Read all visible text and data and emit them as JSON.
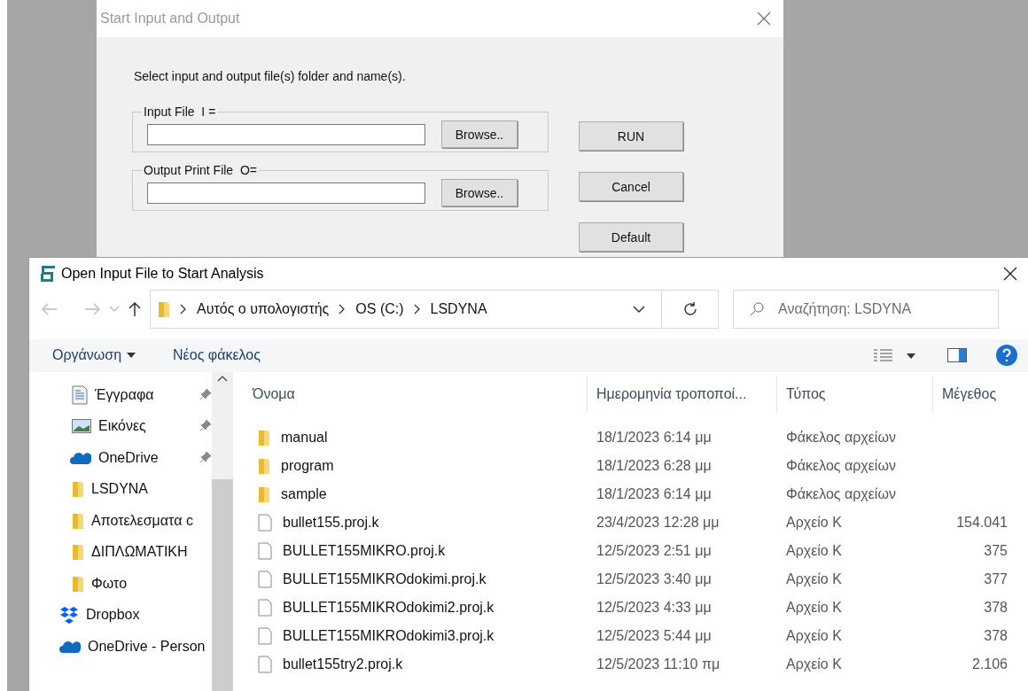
{
  "setup_dialog": {
    "title": "Start Input and Output",
    "instruction": "Select input and output file(s) folder and name(s).",
    "groups": [
      {
        "legend": "Input File  I =",
        "browse": "Browse.."
      },
      {
        "legend": "Output Print File  O=",
        "browse": "Browse.."
      }
    ],
    "buttons": [
      "RUN",
      "Cancel",
      "Default"
    ]
  },
  "open_dialog": {
    "title": "Open Input File to Start Analysis",
    "path": [
      "Αυτός ο υπολογιστής",
      "OS (C:)",
      "LSDYNA"
    ],
    "search": {
      "placeholder": "Αναζήτηση: LSDYNA"
    },
    "toolbar": {
      "organize": "Οργάνωση",
      "new_folder": "Νέος φάκελος"
    },
    "sidebar": [
      {
        "kind": "documents",
        "label": "Έγγραφα",
        "pinned": true
      },
      {
        "kind": "pictures",
        "label": "Εικόνες",
        "pinned": true
      },
      {
        "kind": "cloud",
        "label": "OneDrive",
        "pinned": true
      },
      {
        "kind": "folder",
        "label": "LSDYNA",
        "pinned": false
      },
      {
        "kind": "folder",
        "label": "Αποτελεσματα c",
        "pinned": false
      },
      {
        "kind": "folder",
        "label": "ΔΙΠΛΩΜΑΤΙΚΗ",
        "pinned": false
      },
      {
        "kind": "folder",
        "label": "Φωτο",
        "pinned": false
      },
      {
        "kind": "dropbox",
        "label": "Dropbox",
        "pinned": false
      },
      {
        "kind": "cloud_root",
        "label": "OneDrive - Person",
        "pinned": false
      }
    ],
    "columns": [
      "Όνομα",
      "Ημερομηνία τροποποί...",
      "Τύπος",
      "Μέγεθος"
    ],
    "rows": [
      {
        "kind": "folder",
        "name": "manual",
        "date": "18/1/2023 6:14 μμ",
        "type": "Φάκελος αρχείων"
      },
      {
        "kind": "folder",
        "name": "program",
        "date": "18/1/2023 6:28 μμ",
        "type": "Φάκελος αρχείων"
      },
      {
        "kind": "folder",
        "name": "sample",
        "date": "18/1/2023 6:14 μμ",
        "type": "Φάκελος αρχείων"
      },
      {
        "kind": "file",
        "name": "bullet155.proj.k",
        "date": "23/4/2023 12:28 μμ",
        "type": "Αρχείο K",
        "size": "154.041"
      },
      {
        "kind": "file",
        "name": "BULLET155MIKRO.proj.k",
        "date": "12/5/2023 2:51 μμ",
        "type": "Αρχείο K",
        "size": "375"
      },
      {
        "kind": "file",
        "name": "BULLET155MIKROdokimi.proj.k",
        "date": "12/5/2023 3:40 μμ",
        "type": "Αρχείο K",
        "size": "377"
      },
      {
        "kind": "file",
        "name": "BULLET155MIKROdokimi2.proj.k",
        "date": "12/5/2023 4:33 μμ",
        "type": "Αρχείο K",
        "size": "378"
      },
      {
        "kind": "file",
        "name": "BULLET155MIKROdokimi3.proj.k",
        "date": "12/5/2023 5:44 μμ",
        "type": "Αρχείο K",
        "size": "378"
      },
      {
        "kind": "file",
        "name": "bullet155try2.proj.k",
        "date": "12/5/2023 11:10 πμ",
        "type": "Αρχείο K",
        "size": "2.106"
      }
    ]
  }
}
